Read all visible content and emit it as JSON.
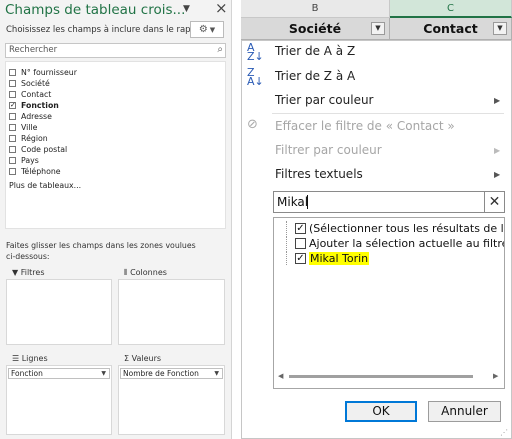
{
  "pivot_pane": {
    "title": "Champs de tableau crois...",
    "subtitle": "Choisissez les champs à inclure dans le rapport :",
    "search_placeholder": "Rechercher",
    "fields": [
      {
        "label": "N° fournisseur",
        "checked": false
      },
      {
        "label": "Société",
        "checked": false
      },
      {
        "label": "Contact",
        "checked": false
      },
      {
        "label": "Fonction",
        "checked": true
      },
      {
        "label": "Adresse",
        "checked": false
      },
      {
        "label": "Ville",
        "checked": false
      },
      {
        "label": "Région",
        "checked": false
      },
      {
        "label": "Code postal",
        "checked": false
      },
      {
        "label": "Pays",
        "checked": false
      },
      {
        "label": "Téléphone",
        "checked": false
      }
    ],
    "more_tables": "Plus de tableaux...",
    "drag_hint": "Faites glisser les champs dans les zones voulues ci-dessous:",
    "zones": {
      "filters": {
        "label": "Filtres",
        "icon": "filter-icon"
      },
      "columns": {
        "label": "Colonnes",
        "icon": "columns-icon"
      },
      "rows": {
        "label": "Lignes",
        "icon": "rows-icon",
        "item": "Fonction"
      },
      "values": {
        "label": "Valeurs",
        "icon": "sigma-icon",
        "item": "Nombre de Fonction"
      }
    }
  },
  "sheet": {
    "columns": [
      "B",
      "C"
    ],
    "headers": [
      "Société",
      "Contact"
    ]
  },
  "filter_menu": {
    "sort_az": "Trier de A à Z",
    "sort_za": "Trier de Z à A",
    "sort_color": "Trier par couleur",
    "clear_filter": "Effacer le filtre de « Contact »",
    "filter_color": "Filtrer par couleur",
    "text_filters": "Filtres textuels",
    "search_value": "Mikal",
    "options": [
      {
        "label": "(Sélectionner tous les résultats de la r",
        "checked": true,
        "highlight": false
      },
      {
        "label": "Ajouter la sélection actuelle au filtre",
        "checked": false,
        "highlight": false
      },
      {
        "label": "Mikal Torin",
        "checked": true,
        "highlight": true
      }
    ],
    "ok": "OK",
    "cancel": "Annuler"
  },
  "colors": {
    "excel_green": "#217346",
    "highlight": "#ffff00",
    "header_gray": "#d9d9d9"
  }
}
